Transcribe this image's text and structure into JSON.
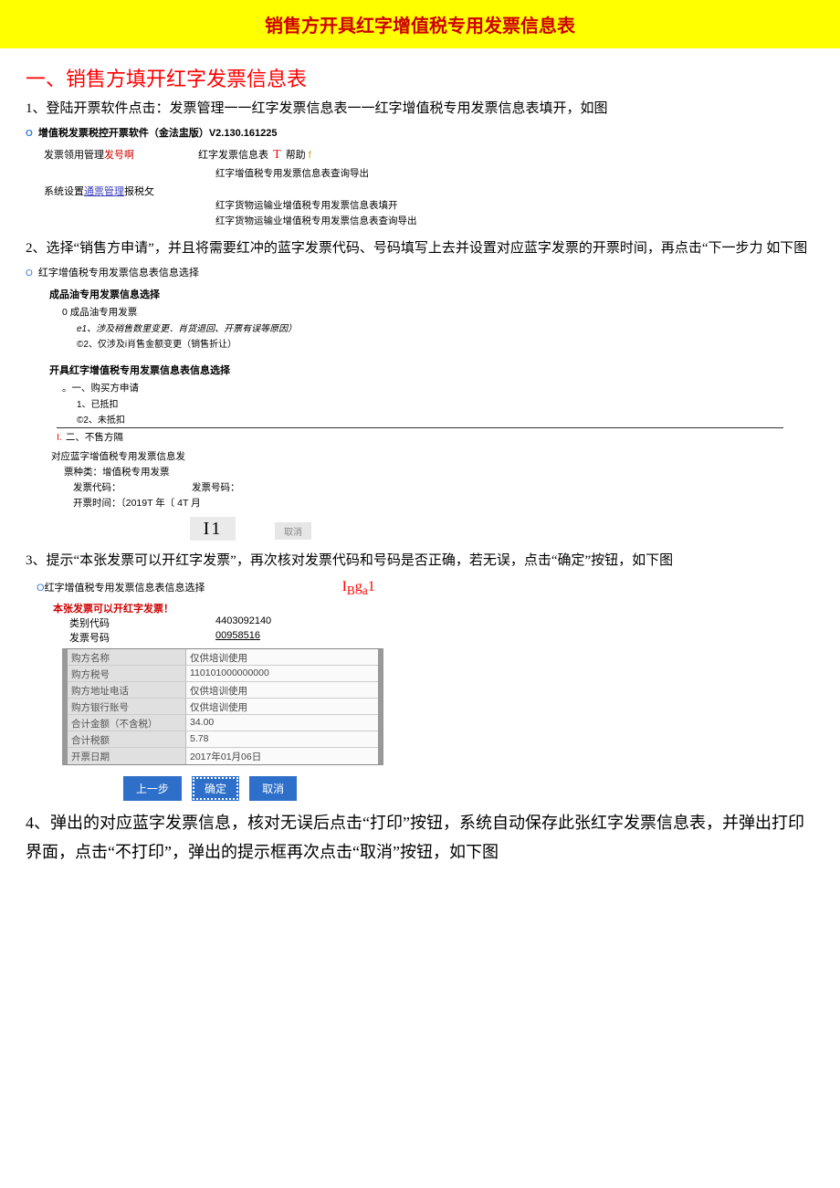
{
  "banner": {
    "title": "销售方开具红字增值税专用发票信息表"
  },
  "section1": {
    "heading": "一、销售方填开红字发票信息表"
  },
  "steps": {
    "s1": "1、登陆开票软件点击：发票管理一一红字发票信息表一一红字增值税专用发票信息表填开，如图",
    "s2": "2、选择“销售方申请”，并且将需要红冲的蓝字发票代码、号码填写上去并设置对应蓝字发票的开票时间，再点击“下一步力 如下图",
    "s3": "3、提示“本张发票可以开红字发票”，再次核对发票代码和号码是否正确，若无误，点击“确定”按钮，如下图",
    "s4": "4、弹出的对应蓝字发票信息，核对无误后点击“打印”按钮，系统自动保存此张红字发票信息表，并弹出打印界面，点击“不打印”，弹出的提示框再次点击“取消”按钮，如下图"
  },
  "sw1": {
    "title": "增值税发票税控开票软件（金法盅版）V2.130.161225",
    "menu1a": "发票领用管理",
    "menu1b": "发号啊",
    "menu1c_a": "红字发票信息表",
    "menu1c_b": "T",
    "menu1c_c": "帮助",
    "menu1c_d": "f",
    "menu2a": "系统设置",
    "menu2b": "通票管理",
    "menu2c": "报税攵",
    "sub1": "红字增值税专用发票信息表查询导出",
    "sub2": "红字货物运输业增值税专用发票信息表填开",
    "sub3": "红字货物运输业增值税专用发票信息表查询导出"
  },
  "dlg2": {
    "title": "红字增值税专用发票信息表信息选择",
    "g1": "成品油专用发票信息选择",
    "g1a": "0 成品油专用发票",
    "g1b": "e1、涉及稍售数里变更．肖货退回、开票有误等原因）",
    "g1c": "©2、仅涉及i肖售金额变更（销售折让）",
    "g2": "开具红字增值税专用发票信息表信息选择",
    "g2a": "。一、购买方申请",
    "g2a1": "1、已抵扣",
    "g2a2": "©2、未抵扣",
    "g2b_pre": "I.",
    "g2b": "二、不售方隔",
    "g3_1": "对应蓝字增值税专用发票信息发",
    "g3_2": "票种类：增值税专用发票",
    "f1k": "发票代码：",
    "f1v": "发票号码：",
    "f2": "开票时间：〔2019T 年〔 4T 月",
    "next": "I1",
    "cancel": "取消"
  },
  "dlg3": {
    "title": "红字增值税专用发票信息表信息选择",
    "iga": "IBga1",
    "hint": "本张发票可以开红字发票！",
    "k1": "类别代码",
    "v1": "4403092140",
    "k2": "发票号码",
    "v2": "00958516",
    "rows": [
      {
        "k": "购方名称",
        "v": "仅供培训使用"
      },
      {
        "k": "购方税号",
        "v": "110101000000000"
      },
      {
        "k": "购方地址电话",
        "v": "仅供培训使用"
      },
      {
        "k": "购方银行账号",
        "v": "仅供培训使用"
      },
      {
        "k": "合计金额（不含税）",
        "v": "34.00"
      },
      {
        "k": "合计税额",
        "v": "5.78"
      },
      {
        "k": "开票日期",
        "v": "2017年01月06日"
      }
    ],
    "btn_prev": "上一步",
    "btn_ok": "确定",
    "btn_cancel": "取消"
  }
}
